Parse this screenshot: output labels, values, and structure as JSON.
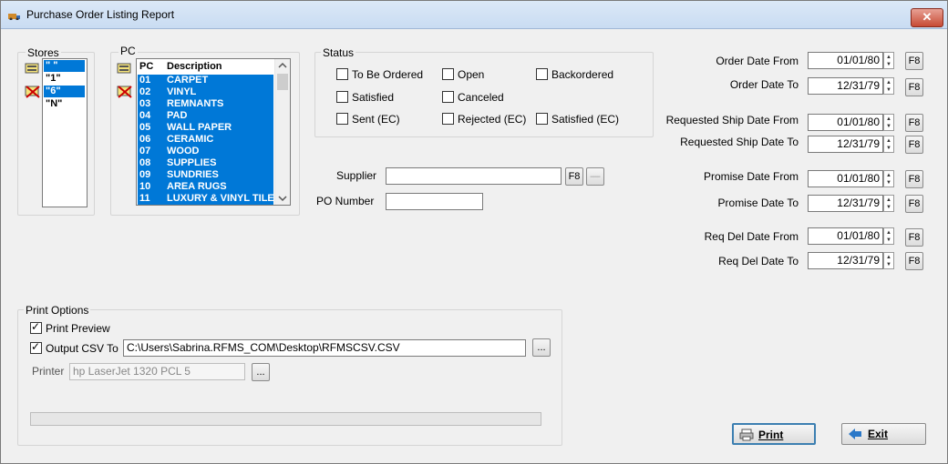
{
  "window": {
    "title": "Purchase Order Listing Report",
    "close_label": "✕"
  },
  "stores": {
    "label": "Stores",
    "items": [
      {
        "text": "\" \"",
        "selected": true
      },
      {
        "text": "\"1\"",
        "selected": false
      },
      {
        "text": "\"6\"",
        "selected": true
      },
      {
        "text": "\"N\"",
        "selected": false
      }
    ]
  },
  "pc": {
    "label": "PC",
    "headers": {
      "code": "PC",
      "description": "Description"
    },
    "rows": [
      {
        "code": "01",
        "description": "CARPET"
      },
      {
        "code": "02",
        "description": "VINYL"
      },
      {
        "code": "03",
        "description": "REMNANTS"
      },
      {
        "code": "04",
        "description": "PAD"
      },
      {
        "code": "05",
        "description": "WALL PAPER"
      },
      {
        "code": "06",
        "description": "CERAMIC"
      },
      {
        "code": "07",
        "description": "WOOD"
      },
      {
        "code": "08",
        "description": "SUPPLIES"
      },
      {
        "code": "09",
        "description": "SUNDRIES"
      },
      {
        "code": "10",
        "description": "AREA RUGS"
      },
      {
        "code": "11",
        "description": "LUXURY & VINYL TILE"
      }
    ]
  },
  "status": {
    "label": "Status",
    "options": {
      "to_be_ordered": "To Be Ordered",
      "open": "Open",
      "backordered": "Backordered",
      "satisfied": "Satisfied",
      "canceled": "Canceled",
      "sent_ec": "Sent (EC)",
      "rejected_ec": "Rejected (EC)",
      "satisfied_ec": "Satisfied (EC)"
    }
  },
  "supplier": {
    "label": "Supplier",
    "value": "",
    "f8": "F8",
    "dash": "—"
  },
  "po_number": {
    "label": "PO Number",
    "value": ""
  },
  "dates": {
    "f8": "F8",
    "order_from": {
      "label": "Order Date From",
      "value": "01/01/80"
    },
    "order_to": {
      "label": "Order Date To",
      "value": "12/31/79"
    },
    "req_ship_from": {
      "label": "Requested Ship Date From",
      "value": "01/01/80"
    },
    "req_ship_to": {
      "label": "Requested Ship Date To",
      "value": "12/31/79"
    },
    "promise_from": {
      "label": "Promise Date From",
      "value": "01/01/80"
    },
    "promise_to": {
      "label": "Promise Date To",
      "value": "12/31/79"
    },
    "req_del_from": {
      "label": "Req Del Date From",
      "value": "01/01/80"
    },
    "req_del_to": {
      "label": "Req Del Date To",
      "value": "12/31/79"
    }
  },
  "print_options": {
    "label": "Print Options",
    "print_preview": {
      "label": "Print Preview",
      "checked": true
    },
    "output_csv": {
      "label": "Output CSV To",
      "checked": true,
      "path": "C:\\Users\\Sabrina.RFMS_COM\\Desktop\\RFMSCSV.CSV",
      "browse": "..."
    },
    "printer": {
      "label": "Printer",
      "value": "hp LaserJet 1320 PCL 5",
      "browse": "..."
    }
  },
  "actions": {
    "print": "Print",
    "exit": "Exit"
  },
  "colors": {
    "selection": "#0078d7",
    "close": "#c74a34"
  }
}
